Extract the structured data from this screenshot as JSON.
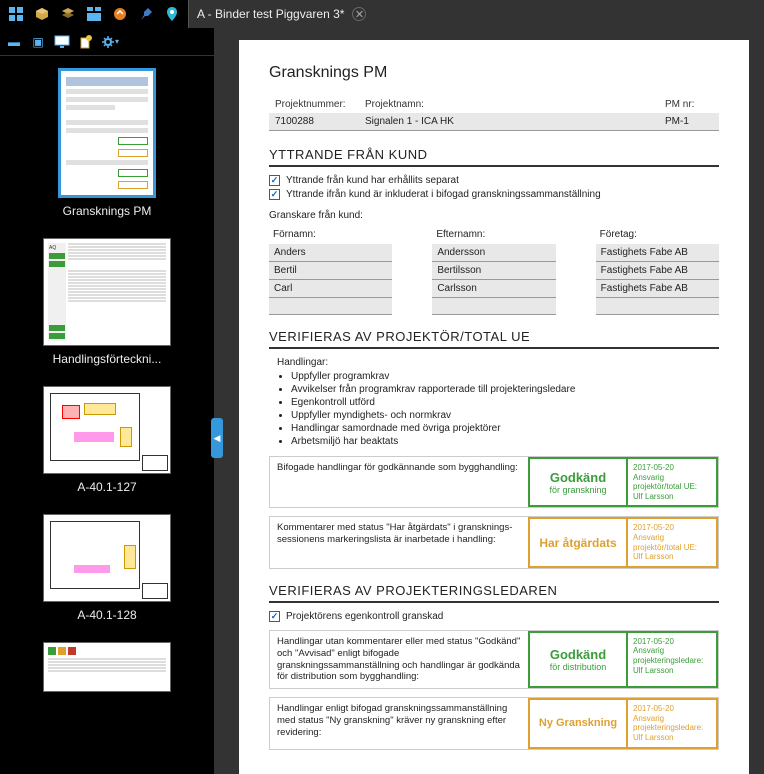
{
  "tab": {
    "title": "A - Binder test Piggvaren 3*"
  },
  "thumbnails": [
    {
      "label": "Gransknings PM"
    },
    {
      "label": "Handlingsförteckni..."
    },
    {
      "label": "A-40.1-127"
    },
    {
      "label": "A-40.1-128"
    }
  ],
  "doc": {
    "title": "Gransknings PM",
    "meta": {
      "h1": "Projektnummer:",
      "h2": "Projektnamn:",
      "h3": "PM nr:",
      "v1": "7100288",
      "v2": "Signalen 1 - ICA HK",
      "v3": "PM-1"
    },
    "s1": {
      "heading": "YTTRANDE FRÅN KUND",
      "chk1": "Yttrande från kund har erhållits separat",
      "chk2": "Yttrande ifrån kund är inkluderat i bifogad granskningssammanställning",
      "sub": "Granskare från kund:",
      "col1": "Förnamn:",
      "col2": "Efternamn:",
      "col3": "Företag:",
      "rows": [
        {
          "f": "Anders",
          "e": "Andersson",
          "c": "Fastighets Fabe AB"
        },
        {
          "f": "Bertil",
          "e": "Bertilsson",
          "c": "Fastighets Fabe AB"
        },
        {
          "f": "Carl",
          "e": "Carlsson",
          "c": "Fastighets Fabe AB"
        }
      ]
    },
    "s2": {
      "heading": "VERIFIERAS AV PROJEKTÖR/TOTAL UE",
      "hlabel": "Handlingar:",
      "bullets": [
        "Uppfyller programkrav",
        "Avvikelser från programkrav rapporterade till projekteringsledare",
        "Egenkontroll utförd",
        "Uppfyller myndighets- och normkrav",
        "Handlingar samordnade med övriga projektörer",
        "Arbetsmiljö har beaktats"
      ],
      "r1": {
        "text": "Bifogade handlingar för godkännande som bygghandling:",
        "big": "Godkänd",
        "small": "för granskning",
        "date": "2017-05-20",
        "role": "Ansvarig projektör/total UE:",
        "name": "Ulf Larsson"
      },
      "r2": {
        "text1": "Kommentarer med status \"Har åtgärdats\" i gransknings-",
        "text2": "sessionens markeringslista är inarbetade i handling:",
        "big": "Har åtgärdats",
        "date": "2017-05-20",
        "role": "Ansvarig projektör/total UE:",
        "name": "Ulf Larsson"
      }
    },
    "s3": {
      "heading": "VERIFIERAS AV PROJEKTERINGSLEDAREN",
      "chk": "Projektörens egenkontroll granskad",
      "r1": {
        "text": "Handlingar utan kommentarer eller med status \"Godkänd\" och \"Avvisad\" enligt bifogade granskningssammanställning och handlingar är godkända för distribution som bygghandling:",
        "big": "Godkänd",
        "small": "för distribution",
        "date": "2017-05-20",
        "role": "Ansvarig projekteringsledare:",
        "name": "Ulf Larsson"
      },
      "r2": {
        "text": "Handlingar enligt bifogad granskningssammanställning med status \"Ny granskning\" kräver ny granskning efter revidering:",
        "big": "Ny Granskning",
        "date": "2017-05-20",
        "role": "Ansvarig projekteringsledare:",
        "name": "Ulf Larsson"
      }
    }
  }
}
